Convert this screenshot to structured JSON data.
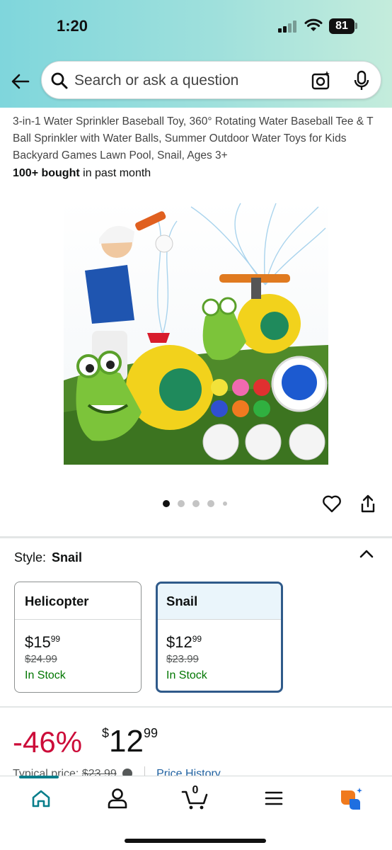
{
  "status_bar": {
    "time": "1:20",
    "battery": "81"
  },
  "search": {
    "placeholder": "Search or ask a question"
  },
  "product": {
    "title": "3-in-1 Water Sprinkler Baseball Toy, 360° Rotating Water Baseball Tee & T Ball Sprinkler with Water Balls, Summer Outdoor Water Toys for Kids Backyard Games Lawn Pool, Snail, Ages 3+",
    "bought_bold": "100+ bought",
    "bought_rest": " in past month",
    "image_count": 5,
    "active_image_index": 0
  },
  "style": {
    "label": "Style:",
    "selected": "Snail",
    "options": [
      {
        "name": "Helicopter",
        "price_dollars": "$15",
        "price_cents": "99",
        "list_price": "$24.99",
        "availability": "In Stock",
        "selected": false
      },
      {
        "name": "Snail",
        "price_dollars": "$12",
        "price_cents": "99",
        "list_price": "$23.99",
        "availability": "In Stock",
        "selected": true
      }
    ]
  },
  "pricing": {
    "discount": "-46%",
    "currency": "$",
    "dollars": "12",
    "cents": "99",
    "typical_label": "Typical price:",
    "typical_value": "$23.99",
    "price_history": "Price History"
  },
  "nav": {
    "items": [
      "home-icon",
      "account-icon",
      "cart-icon",
      "menu-icon",
      "rufus-icon"
    ],
    "cart_count": "0"
  },
  "colors": {
    "accent": "#087e8b",
    "discount": "#cc0c39",
    "in_stock": "#007600",
    "link": "#2162a1",
    "selected_border": "#2f5a8a"
  }
}
